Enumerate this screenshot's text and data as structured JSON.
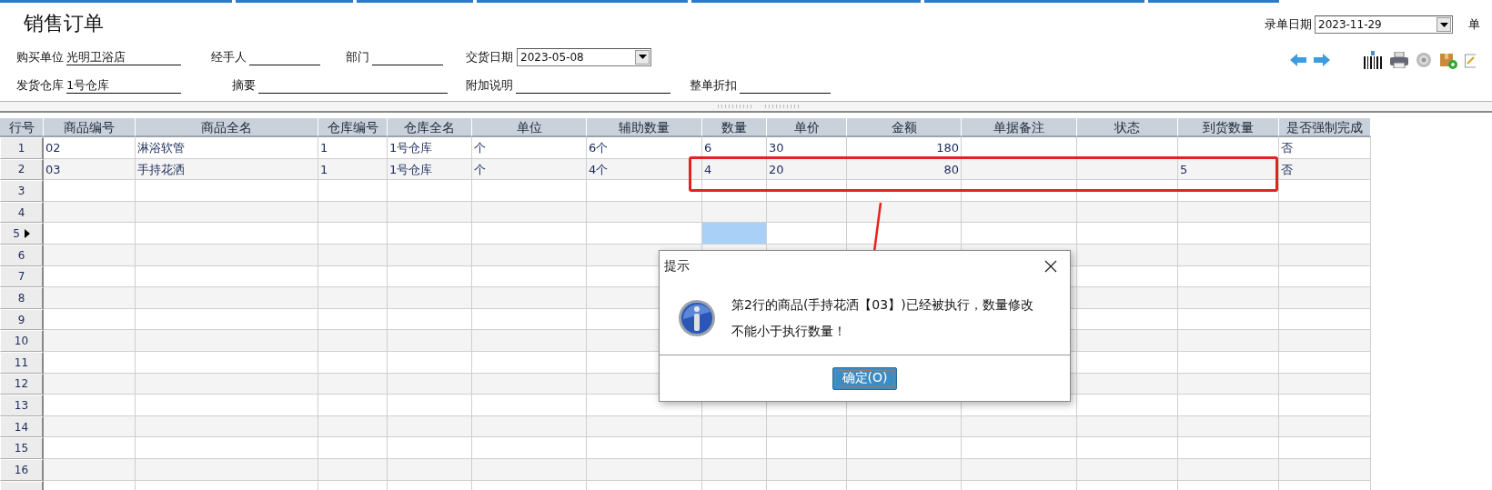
{
  "title": "销售订单",
  "form": {
    "fields": [
      {
        "label": "购买单位",
        "value": "光明卫浴店",
        "kind": "text"
      },
      {
        "label": "经手人",
        "kind": "text"
      },
      {
        "label": "部门",
        "kind": "text"
      },
      {
        "label": "交货日期",
        "value": "2023-05-08",
        "kind": "date"
      },
      {
        "label": "发货仓库",
        "value": "1号仓库",
        "kind": "text"
      },
      {
        "label": "摘要",
        "kind": "text"
      },
      {
        "label": "附加说明",
        "kind": "text"
      },
      {
        "label": "整单折扣",
        "kind": "text"
      }
    ]
  },
  "entry_date": {
    "label": "录单日期",
    "value": "2023-11-29"
  },
  "cut_label": "单",
  "table": {
    "columns": [
      {
        "title": "行号",
        "kind": "number"
      },
      {
        "title": "商品编号",
        "kind": "text"
      },
      {
        "title": "商品全名",
        "kind": "text"
      },
      {
        "title": "仓库编号",
        "kind": "text"
      },
      {
        "title": "仓库全名",
        "kind": "text"
      },
      {
        "title": "单位",
        "kind": "text"
      },
      {
        "title": "辅助数量",
        "kind": "text"
      },
      {
        "title": "数量",
        "kind": "quantity"
      },
      {
        "title": "单价",
        "kind": "text"
      },
      {
        "title": "金额",
        "kind": "amount"
      },
      {
        "title": "单据备注",
        "kind": "text"
      },
      {
        "title": "状态",
        "kind": "text"
      },
      {
        "title": "到货数量",
        "kind": "text"
      },
      {
        "title": "是否强制完成",
        "kind": "text"
      }
    ],
    "rows": [
      {
        "number": "1",
        "current": false,
        "cells": [
          "02",
          "淋浴软管",
          "1",
          "1号仓库",
          "个",
          "6个",
          "6",
          "30",
          "180",
          null,
          null,
          null,
          "否"
        ]
      },
      {
        "number": "2",
        "current": false,
        "cells": [
          "03",
          "手持花洒",
          "1",
          "1号仓库",
          "个",
          "4个",
          "4",
          "20",
          "80",
          null,
          null,
          "5",
          "否"
        ]
      },
      {
        "number": "3",
        "current": false
      },
      {
        "number": "4",
        "current": false
      },
      {
        "number": "5",
        "current": true
      },
      {
        "number": "6",
        "current": false
      },
      {
        "number": "7",
        "current": false
      },
      {
        "number": "8",
        "current": false
      },
      {
        "number": "9",
        "current": false
      },
      {
        "number": "10",
        "current": false
      },
      {
        "number": "11",
        "current": false
      },
      {
        "number": "12",
        "current": false
      },
      {
        "number": "13",
        "current": false
      },
      {
        "number": "14",
        "current": false
      },
      {
        "number": "15",
        "current": false
      },
      {
        "number": "16",
        "current": false
      }
    ]
  },
  "annotations": {
    "highlight_box": true,
    "arrow": true
  },
  "dialog": {
    "title": "提示",
    "message": "第2行的商品(手持花洒【03】)已经被执行，数量修改不能小于执行数量！",
    "button": "确定(O)"
  }
}
